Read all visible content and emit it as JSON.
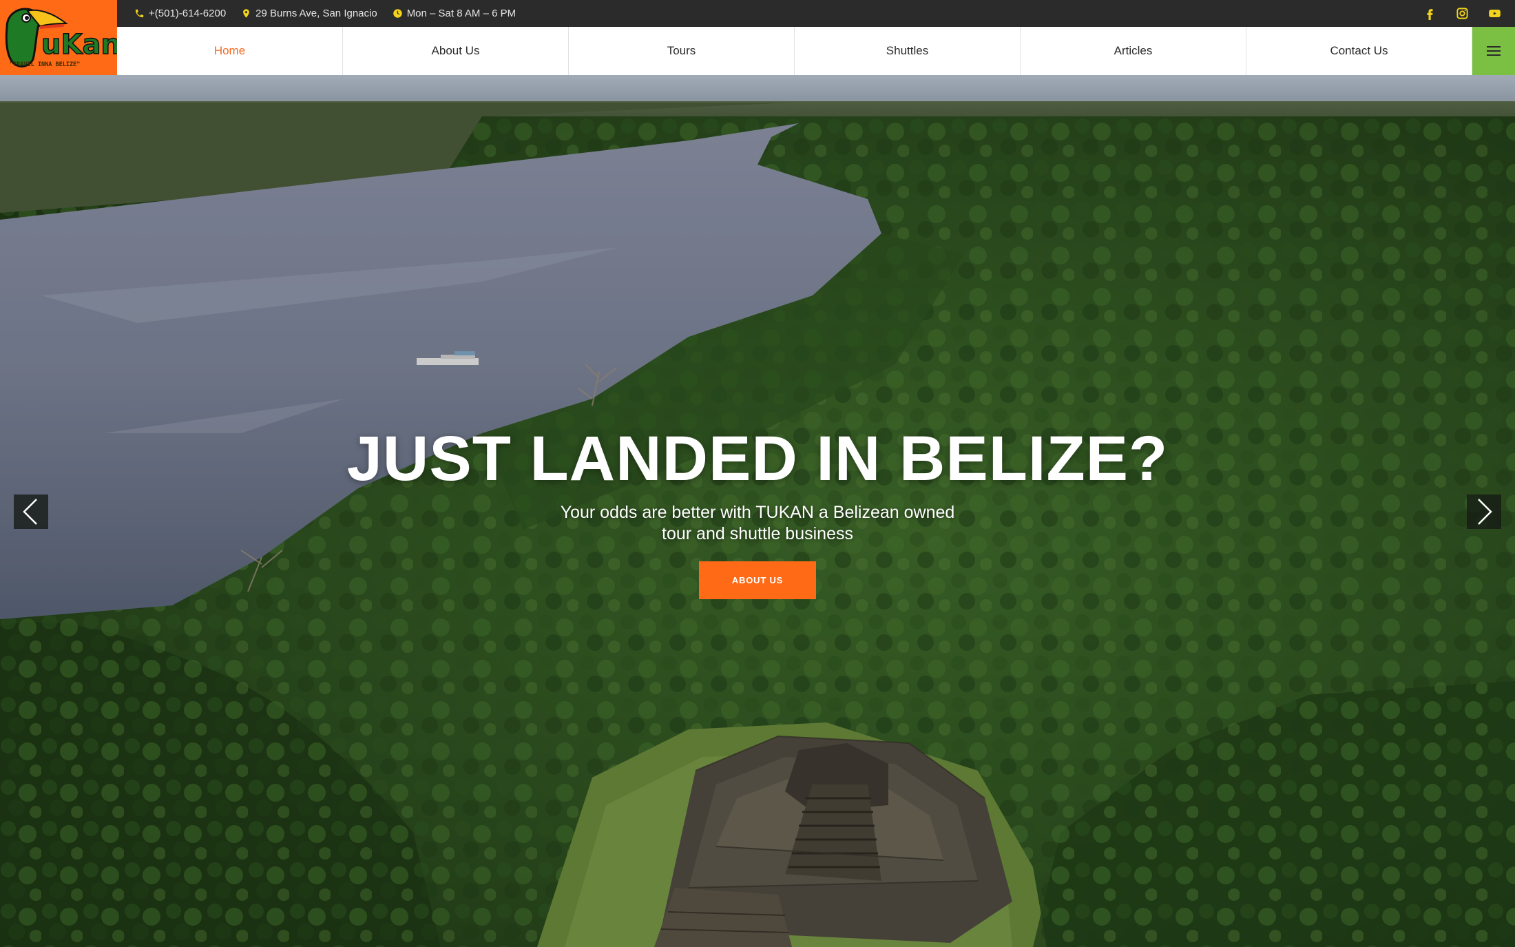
{
  "topbar": {
    "phone": "+(501)-614-6200",
    "address": "29 Burns Ave, San Ignacio",
    "hours": "Mon – Sat 8 AM – 6 PM",
    "social": [
      "facebook-icon",
      "instagram-icon",
      "youtube-icon"
    ],
    "icon_color": "#f2d21c"
  },
  "logo": {
    "brand": "TuKan",
    "tagline": "\"TRAVEL INNA BELIZE\"",
    "bg_color": "#ff6a16"
  },
  "nav": {
    "items": [
      {
        "label": "Home",
        "active": true
      },
      {
        "label": "About Us"
      },
      {
        "label": "Tours"
      },
      {
        "label": "Shuttles"
      },
      {
        "label": "Articles"
      },
      {
        "label": "Contact Us"
      }
    ],
    "active_color": "#f26a22",
    "menu_button_color": "#7bc043"
  },
  "hero": {
    "title": "JUST LANDED IN BELIZE?",
    "subtitle_line1": "Your odds are better with TUKAN a Belizean owned",
    "subtitle_line2": "tour and shuttle business",
    "button_label": "ABOUT US",
    "button_color": "#ff6a16"
  }
}
